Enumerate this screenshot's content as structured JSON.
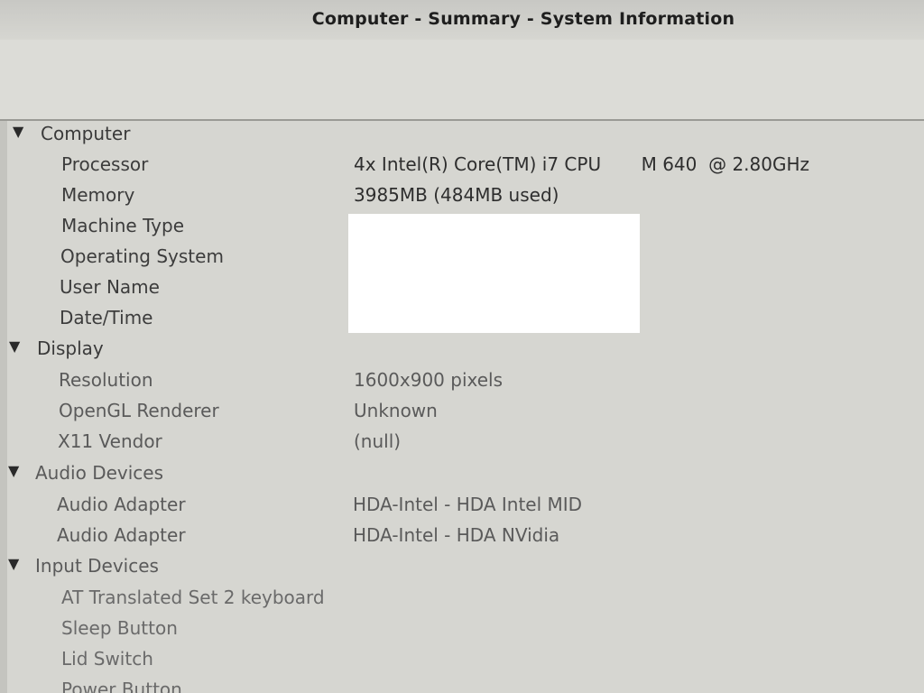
{
  "window": {
    "title": "Computer - Summary - System Information"
  },
  "tree": {
    "computer": {
      "label": "Computer",
      "items": [
        {
          "key": "Processor",
          "value": "4x Intel(R) Core(TM) i7 CPU       M 640  @ 2.80GHz"
        },
        {
          "key": "Memory",
          "value": "3985MB (484MB used)"
        },
        {
          "key": "Machine Type",
          "value": ""
        },
        {
          "key": "Operating System",
          "value": ""
        },
        {
          "key": "User Name",
          "value": ""
        },
        {
          "key": "Date/Time",
          "value": ""
        }
      ]
    },
    "display": {
      "label": "Display",
      "items": [
        {
          "key": "Resolution",
          "value": "1600x900 pixels"
        },
        {
          "key": "OpenGL Renderer",
          "value": "Unknown"
        },
        {
          "key": "X11 Vendor",
          "value": "(null)"
        }
      ]
    },
    "audio": {
      "label": "Audio Devices",
      "items": [
        {
          "key": "Audio Adapter",
          "value": "HDA-Intel - HDA Intel MID"
        },
        {
          "key": "Audio Adapter",
          "value": "HDA-Intel - HDA NVidia"
        }
      ]
    },
    "input": {
      "label": "Input Devices",
      "items": [
        {
          "key": "AT Translated Set 2 keyboard"
        },
        {
          "key": "Sleep Button"
        },
        {
          "key": "Lid Switch"
        },
        {
          "key": "Power Button"
        }
      ]
    },
    "expander_glyph": "▼"
  }
}
